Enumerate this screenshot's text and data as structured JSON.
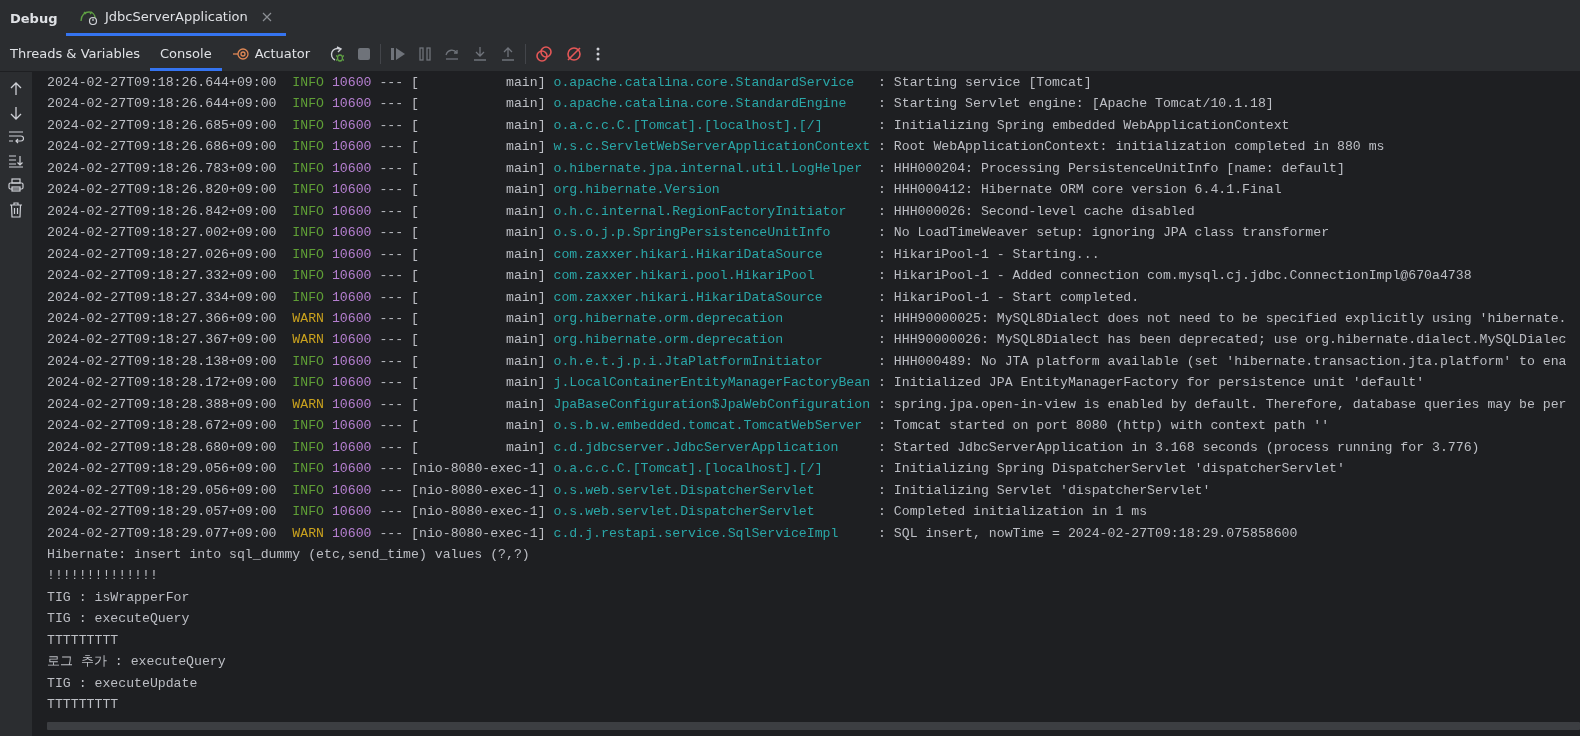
{
  "window": {
    "title": "Debug"
  },
  "session_tabs": [
    {
      "label": "JdbcServerApplication",
      "selected": true
    }
  ],
  "tabs": [
    {
      "label": "Threads & Variables",
      "selected": false
    },
    {
      "label": "Console",
      "selected": true
    },
    {
      "label": "Actuator",
      "selected": false
    }
  ],
  "console": {
    "lines": [
      {
        "kind": "log",
        "timestamp": "2024-02-27T09:18:26.644+09:00",
        "level": "INFO",
        "pid": "10600",
        "separator": "---",
        "thread": "[           main]",
        "logger": "o.apache.catalina.core.StandardService",
        "message": ": Starting service [Tomcat]"
      },
      {
        "kind": "log",
        "timestamp": "2024-02-27T09:18:26.644+09:00",
        "level": "INFO",
        "pid": "10600",
        "separator": "---",
        "thread": "[           main]",
        "logger": "o.apache.catalina.core.StandardEngine",
        "message": ": Starting Servlet engine: [Apache Tomcat/10.1.18]"
      },
      {
        "kind": "log",
        "timestamp": "2024-02-27T09:18:26.685+09:00",
        "level": "INFO",
        "pid": "10600",
        "separator": "---",
        "thread": "[           main]",
        "logger": "o.a.c.c.C.[Tomcat].[localhost].[/]",
        "message": ": Initializing Spring embedded WebApplicationContext"
      },
      {
        "kind": "log",
        "timestamp": "2024-02-27T09:18:26.686+09:00",
        "level": "INFO",
        "pid": "10600",
        "separator": "---",
        "thread": "[           main]",
        "logger": "w.s.c.ServletWebServerApplicationContext",
        "message": ": Root WebApplicationContext: initialization completed in 880 ms"
      },
      {
        "kind": "log",
        "timestamp": "2024-02-27T09:18:26.783+09:00",
        "level": "INFO",
        "pid": "10600",
        "separator": "---",
        "thread": "[           main]",
        "logger": "o.hibernate.jpa.internal.util.LogHelper",
        "message": ": HHH000204: Processing PersistenceUnitInfo [name: default]"
      },
      {
        "kind": "log",
        "timestamp": "2024-02-27T09:18:26.820+09:00",
        "level": "INFO",
        "pid": "10600",
        "separator": "---",
        "thread": "[           main]",
        "logger": "org.hibernate.Version",
        "message": ": HHH000412: Hibernate ORM core version 6.4.1.Final"
      },
      {
        "kind": "log",
        "timestamp": "2024-02-27T09:18:26.842+09:00",
        "level": "INFO",
        "pid": "10600",
        "separator": "---",
        "thread": "[           main]",
        "logger": "o.h.c.internal.RegionFactoryInitiator",
        "message": ": HHH000026: Second-level cache disabled"
      },
      {
        "kind": "log",
        "timestamp": "2024-02-27T09:18:27.002+09:00",
        "level": "INFO",
        "pid": "10600",
        "separator": "---",
        "thread": "[           main]",
        "logger": "o.s.o.j.p.SpringPersistenceUnitInfo",
        "message": ": No LoadTimeWeaver setup: ignoring JPA class transformer"
      },
      {
        "kind": "log",
        "timestamp": "2024-02-27T09:18:27.026+09:00",
        "level": "INFO",
        "pid": "10600",
        "separator": "---",
        "thread": "[           main]",
        "logger": "com.zaxxer.hikari.HikariDataSource",
        "message": ": HikariPool-1 - Starting..."
      },
      {
        "kind": "log",
        "timestamp": "2024-02-27T09:18:27.332+09:00",
        "level": "INFO",
        "pid": "10600",
        "separator": "---",
        "thread": "[           main]",
        "logger": "com.zaxxer.hikari.pool.HikariPool",
        "message": ": HikariPool-1 - Added connection com.mysql.cj.jdbc.ConnectionImpl@670a4738"
      },
      {
        "kind": "log",
        "timestamp": "2024-02-27T09:18:27.334+09:00",
        "level": "INFO",
        "pid": "10600",
        "separator": "---",
        "thread": "[           main]",
        "logger": "com.zaxxer.hikari.HikariDataSource",
        "message": ": HikariPool-1 - Start completed."
      },
      {
        "kind": "log",
        "timestamp": "2024-02-27T09:18:27.366+09:00",
        "level": "WARN",
        "pid": "10600",
        "separator": "---",
        "thread": "[           main]",
        "logger": "org.hibernate.orm.deprecation",
        "message": ": HHH90000025: MySQL8Dialect does not need to be specified explicitly using 'hibernate."
      },
      {
        "kind": "log",
        "timestamp": "2024-02-27T09:18:27.367+09:00",
        "level": "WARN",
        "pid": "10600",
        "separator": "---",
        "thread": "[           main]",
        "logger": "org.hibernate.orm.deprecation",
        "message": ": HHH90000026: MySQL8Dialect has been deprecated; use org.hibernate.dialect.MySQLDialec"
      },
      {
        "kind": "log",
        "timestamp": "2024-02-27T09:18:28.138+09:00",
        "level": "INFO",
        "pid": "10600",
        "separator": "---",
        "thread": "[           main]",
        "logger": "o.h.e.t.j.p.i.JtaPlatformInitiator",
        "message": ": HHH000489: No JTA platform available (set 'hibernate.transaction.jta.platform' to ena"
      },
      {
        "kind": "log",
        "timestamp": "2024-02-27T09:18:28.172+09:00",
        "level": "INFO",
        "pid": "10600",
        "separator": "---",
        "thread": "[           main]",
        "logger": "j.LocalContainerEntityManagerFactoryBean",
        "message": ": Initialized JPA EntityManagerFactory for persistence unit 'default'"
      },
      {
        "kind": "log",
        "timestamp": "2024-02-27T09:18:28.388+09:00",
        "level": "WARN",
        "pid": "10600",
        "separator": "---",
        "thread": "[           main]",
        "logger": "JpaBaseConfiguration$JpaWebConfiguration",
        "message": ": spring.jpa.open-in-view is enabled by default. Therefore, database queries may be per"
      },
      {
        "kind": "log",
        "timestamp": "2024-02-27T09:18:28.672+09:00",
        "level": "INFO",
        "pid": "10600",
        "separator": "---",
        "thread": "[           main]",
        "logger": "o.s.b.w.embedded.tomcat.TomcatWebServer",
        "message": ": Tomcat started on port 8080 (http) with context path ''"
      },
      {
        "kind": "log",
        "timestamp": "2024-02-27T09:18:28.680+09:00",
        "level": "INFO",
        "pid": "10600",
        "separator": "---",
        "thread": "[           main]",
        "logger": "c.d.jdbcserver.JdbcServerApplication",
        "message": ": Started JdbcServerApplication in 3.168 seconds (process running for 3.776)"
      },
      {
        "kind": "log",
        "timestamp": "2024-02-27T09:18:29.056+09:00",
        "level": "INFO",
        "pid": "10600",
        "separator": "---",
        "thread": "[nio-8080-exec-1]",
        "logger": "o.a.c.c.C.[Tomcat].[localhost].[/]",
        "message": ": Initializing Spring DispatcherServlet 'dispatcherServlet'"
      },
      {
        "kind": "log",
        "timestamp": "2024-02-27T09:18:29.056+09:00",
        "level": "INFO",
        "pid": "10600",
        "separator": "---",
        "thread": "[nio-8080-exec-1]",
        "logger": "o.s.web.servlet.DispatcherServlet",
        "message": ": Initializing Servlet 'dispatcherServlet'"
      },
      {
        "kind": "log",
        "timestamp": "2024-02-27T09:18:29.057+09:00",
        "level": "INFO",
        "pid": "10600",
        "separator": "---",
        "thread": "[nio-8080-exec-1]",
        "logger": "o.s.web.servlet.DispatcherServlet",
        "message": ": Completed initialization in 1 ms"
      },
      {
        "kind": "log",
        "timestamp": "2024-02-27T09:18:29.077+09:00",
        "level": "WARN",
        "pid": "10600",
        "separator": "---",
        "thread": "[nio-8080-exec-1]",
        "logger": "c.d.j.restapi.service.SqlServiceImpl",
        "message": ": SQL insert, nowTime = 2024-02-27T09:18:29.075858600"
      },
      {
        "kind": "plain",
        "text": "Hibernate: insert into sql_dummy (etc,send_time) values (?,?)"
      },
      {
        "kind": "plain",
        "text": "!!!!!!!!!!!!!!"
      },
      {
        "kind": "plain",
        "text": "TIG : isWrapperFor"
      },
      {
        "kind": "plain",
        "text": "TIG : executeQuery"
      },
      {
        "kind": "plain",
        "text": "TTTTTTTTT"
      },
      {
        "kind": "plain",
        "text": "로그 추가 : executeQuery"
      },
      {
        "kind": "plain",
        "text": "TIG : executeUpdate"
      },
      {
        "kind": "plain",
        "text": "TTTTTTTTT"
      }
    ]
  }
}
